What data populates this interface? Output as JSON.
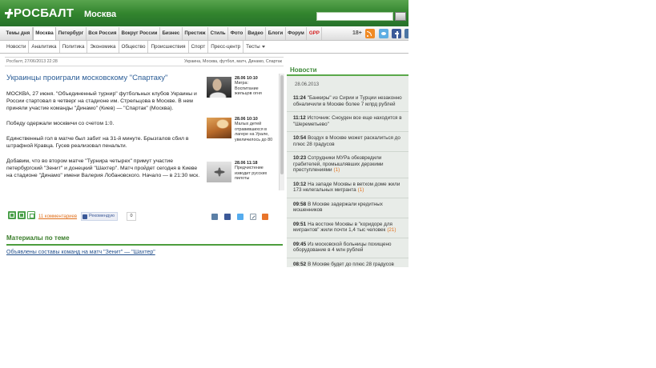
{
  "header": {
    "logo_text": "РОСБАЛТ",
    "city": "Москва"
  },
  "nav_main": {
    "items": [
      "Темы дня",
      "Москва",
      "Петербург",
      "Вся Россия",
      "Вокруг России",
      "Бизнес",
      "Престиж",
      "Стиль",
      "Фото",
      "Видео",
      "Блоги",
      "Форум",
      "GPP"
    ],
    "active_index": 1,
    "highlight_index": 12,
    "age_badge": "18+",
    "social_icons": [
      "rss-icon",
      "twitter-icon",
      "facebook-icon",
      "vk-icon"
    ]
  },
  "nav_sub": {
    "items": [
      "Новости",
      "Аналитика",
      "Политика",
      "Экономика",
      "Общество",
      "Происшествия",
      "Спорт",
      "Пресс-центр",
      "Тесты"
    ]
  },
  "article": {
    "source_date": "Росбалт, 27/06/2013 22:28",
    "tags": "Украина, Москва, футбол, матч, Динамо, Спартак",
    "title": "Украинцы проиграли московскому \"Спартаку\"",
    "paragraphs": [
      "МОСКВА, 27 июня. \"Объединенный турнир\" футбольных клубов Украины и России стартовал в четверг на стадионе им. Стрельцова в Москве. В нем приняли участие команды \"Динамо\" (Киев) — \"Спартак\" (Москва).",
      "Победу одержали москвичи со счетом 1:0.",
      "Единственный гол в матче был забит на 31-й минуте. Брызгалов сбил в штрафной Кравца. Гусев реализовал пенальти.",
      "Добавим, что во втором матче \"Турнира четырех\" примут участие петербургский \"Зенит\" и донецкий \"Шахтер\". Матч пройдет сегодня в Киеве на стадионе \"Динамо\" имени Валерия Лобановского. Начало — в 21:30 мск."
    ],
    "comments_link": "11 комментариев",
    "fb_like_label": "Рекомендую",
    "fb_like_count": "0",
    "tool_icons": [
      "word-icon",
      "email-icon",
      "print-icon"
    ],
    "share_icons": [
      "vk-icon",
      "facebook-icon",
      "twitter-icon",
      "link-icon",
      "odnoklassniki-icon"
    ]
  },
  "related": [
    {
      "time": "28.06 10:10",
      "text": "Мигра: Воспитание жильцов огня"
    },
    {
      "time": "28.06 10:10",
      "text": "Малых детей отравившихся в лагере на Урале, увеличилось до 80"
    },
    {
      "time": "28.06 11:18",
      "text": "Предчистение изводит русских пилоты"
    }
  ],
  "related_topics": {
    "heading": "Материалы по теме",
    "links": [
      "Объявлены составы команд на матч \"Зенит\" — \"Шахтер\""
    ]
  },
  "news": {
    "heading": "Новости",
    "date": "28.06.2013",
    "items": [
      {
        "time": "11:24",
        "text": "\"Банкиры\" из Сирии и Турции незаконно обналичили в Москве более 7 млрд рублей"
      },
      {
        "time": "11:12",
        "text": "Источник: Сноуден все еще находится в \"Шереметьево\""
      },
      {
        "time": "10:54",
        "text": "Воздух в Москве может раскалиться до плюс 28 градусов"
      },
      {
        "time": "10:23",
        "text": "Сотрудники МУРа обезвредили грабителей, промышлявших дерзкими преступлениями",
        "count": "(1)"
      },
      {
        "time": "10:12",
        "text": "На западе Москвы в ветхом доме жили 173 нелегальных мигранта",
        "count": "(1)"
      },
      {
        "time": "09:58",
        "text": "В Москве задержали кредитных мошенников"
      },
      {
        "time": "09:51",
        "text": "На востоке Москвы в \"коридоре для мигрантов\" жили почти 1,4 тыс человек",
        "count": "(21)"
      },
      {
        "time": "09:45",
        "text": "Из московской больницы похищено оборудование в 4 млн рублей"
      },
      {
        "time": "08:52",
        "text": "В Москве будет до плюс 28 градусов"
      }
    ]
  },
  "colors": {
    "brand_green": "#33852e",
    "accent_orange": "#e0701c",
    "title_blue": "#2a5c96",
    "nav_red": "#d32020",
    "news_bg": "#e8ece8"
  }
}
